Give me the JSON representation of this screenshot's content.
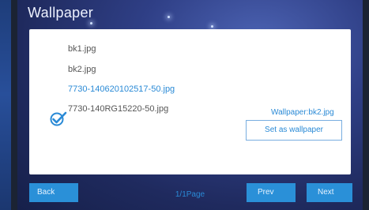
{
  "title": "Wallpaper",
  "files": [
    {
      "name": "bk1.jpg",
      "selected": false
    },
    {
      "name": "bk2.jpg",
      "selected": false
    },
    {
      "name": "7730-140620102517-50.jpg",
      "selected": true
    },
    {
      "name": "7730-140RG15220-50.jpg",
      "selected": false
    }
  ],
  "current_wallpaper": "Wallpaper:bk2.jpg",
  "set_button": "Set as wallpaper",
  "pagination": "1/1Page",
  "buttons": {
    "back": "Back",
    "prev": "Prev",
    "next": "Next"
  },
  "colors": {
    "accent": "#2a8ad6",
    "button": "#2a90d8"
  },
  "icons": {
    "selected": "checkmark-circle-icon"
  }
}
